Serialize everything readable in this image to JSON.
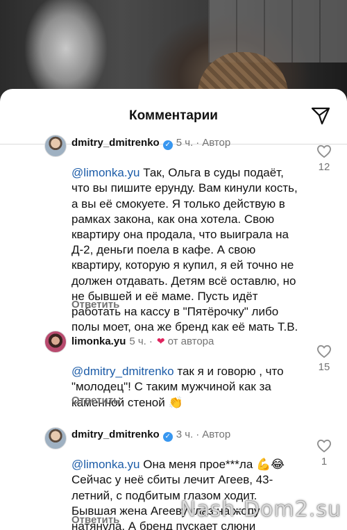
{
  "sheet": {
    "title": "Комментарии"
  },
  "comments": [
    {
      "username": "dmitry_dmitrenko",
      "time": "5 ч.",
      "tag": "Автор",
      "mention": "@limonka.yu",
      "text": " Так, Ольга в суды подаёт, что вы пишите ерунду. Вам кинули кость, а вы её смокуете. Я только действую в рамках закона, как она хотела. Свою квартиру она продала, что выиграла на Д-2, деньги поела в кафе. А свою квартиру, которую я купил, я ей точно не должен отдавать. Детям всё оставлю, но не бывшей и её маме. Пусть идёт работать на кассу в \"Пятёрочку\" либо полы моет, она же бренд как её мать Т.В.",
      "reply": "Ответить",
      "likes": "12"
    },
    {
      "username": "limonka.yu",
      "time": "5 ч.",
      "tag": "от автора",
      "mention": "@dmitry_dmitrenko",
      "text": " так я и говорю , что \"молодец\"! С таким мужчиной как за каменной стеной 👏",
      "reply": "Ответить",
      "likes": "15"
    },
    {
      "username": "dmitry_dmitrenko",
      "time": "3 ч.",
      "tag": "Автор",
      "mention": "@limonka.yu",
      "text": " Она меня прое***ла 💪😂 Сейчас у неё сбиты лечит Агеев, 43-летний, с подбитым глазом ходит. Бывшая жена Агееву глаз на жопу натянула. А бренд пускает слюни",
      "reply": "Ответить",
      "likes": "1"
    }
  ],
  "watermark": "Nash-Dom2.su",
  "colors": {
    "accent": "#3897f0",
    "mention": "#1c5ca8",
    "heart": "#e0245e",
    "muted": "#737373"
  },
  "icons": {
    "send": "paper-plane-icon",
    "like": "heart-outline-icon",
    "verified": "verified-badge-icon"
  }
}
